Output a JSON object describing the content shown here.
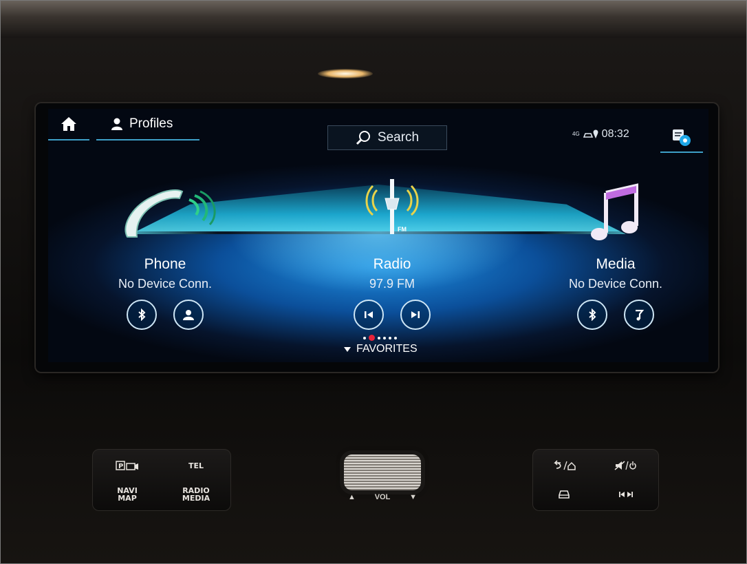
{
  "topbar": {
    "profiles_label": "Profiles",
    "search_label": "Search",
    "status_4g": "4G",
    "clock": "08:32"
  },
  "tiles": {
    "phone": {
      "title": "Phone",
      "subtitle": "No Device Conn.",
      "buttons": [
        "bluetooth-icon",
        "contacts-icon"
      ]
    },
    "radio": {
      "title": "Radio",
      "subtitle": "97.9 FM",
      "band_label": "FM",
      "buttons": [
        "skip-back-icon",
        "skip-forward-icon"
      ]
    },
    "media": {
      "title": "Media",
      "subtitle": "No Device Conn.",
      "buttons": [
        "bluetooth-icon",
        "music-source-icon"
      ]
    }
  },
  "pager": {
    "count": 6,
    "active_index": 1
  },
  "favorites_label": "FAVORITES",
  "hardware": {
    "tel_label": "TEL",
    "navi_map_label": [
      "NAVI",
      "MAP"
    ],
    "radio_media_label": [
      "RADIO",
      "MEDIA"
    ],
    "vol_label": "VOL"
  },
  "colors": {
    "accent": "#3ea0c8",
    "pager_active": "#e8233a",
    "screen_glow": "#1f8ee0"
  }
}
